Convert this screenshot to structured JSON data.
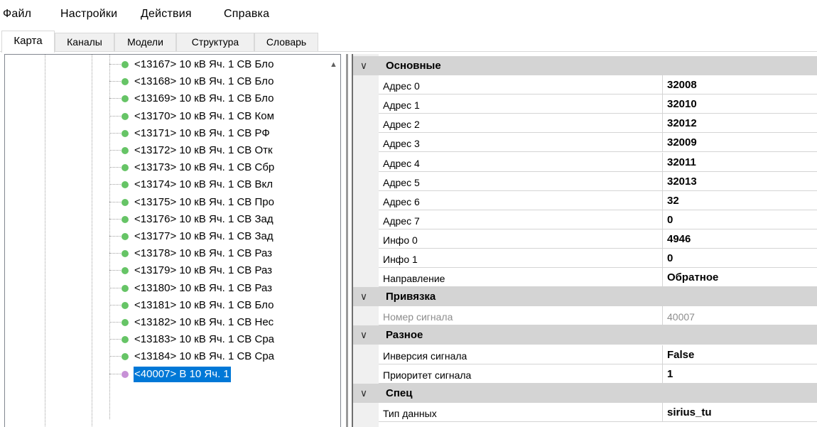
{
  "menu": [
    "Файл",
    "Настройки",
    "Действия",
    "Справка"
  ],
  "tabs": [
    "Карта",
    "Каналы",
    "Модели",
    "Структура",
    "Словарь"
  ],
  "active_tab": "Карта",
  "tree": {
    "items": [
      "<13167> 10 кВ Яч. 1 СВ Бло",
      "<13168> 10 кВ Яч. 1 СВ Бло",
      "<13169> 10 кВ Яч. 1 СВ Бло",
      "<13170> 10 кВ Яч. 1 СВ Ком",
      "<13171> 10 кВ Яч. 1 СВ РФ",
      "<13172> 10 кВ Яч. 1 СВ Отк",
      "<13173> 10 кВ Яч. 1 СВ Сбр",
      "<13174> 10 кВ Яч. 1 СВ Вкл",
      "<13175> 10 кВ Яч. 1 СВ Про",
      "<13176> 10 кВ Яч. 1 СВ Зад",
      "<13177> 10 кВ Яч. 1 СВ Зад",
      "<13178> 10 кВ Яч. 1 СВ Раз",
      "<13179> 10 кВ Яч. 1 СВ Раз",
      "<13180> 10 кВ Яч. 1 СВ Раз",
      "<13181> 10 кВ Яч. 1 СВ Бло",
      "<13182> 10 кВ Яч. 1 СВ Нес",
      "<13183> 10 кВ Яч. 1 СВ Сра",
      "<13184> 10 кВ Яч. 1 СВ Сра"
    ],
    "selected": "<40007> В 10 Яч. 1",
    "node_color": "#66c466",
    "selected_node_color": "#c791d6",
    "selection_color": "#0078d7"
  },
  "properties": {
    "categories": [
      {
        "label": "Основные",
        "rows": [
          {
            "name": "Адрес 0",
            "value": "32008"
          },
          {
            "name": "Адрес 1",
            "value": "32010"
          },
          {
            "name": "Адрес 2",
            "value": "32012"
          },
          {
            "name": "Адрес 3",
            "value": "32009"
          },
          {
            "name": "Адрес 4",
            "value": "32011"
          },
          {
            "name": "Адрес 5",
            "value": "32013"
          },
          {
            "name": "Адрес 6",
            "value": "32"
          },
          {
            "name": "Адрес 7",
            "value": "0"
          },
          {
            "name": "Инфо 0",
            "value": "4946"
          },
          {
            "name": "Инфо 1",
            "value": "0"
          },
          {
            "name": "Направление",
            "value": "Обратное"
          }
        ]
      },
      {
        "label": "Привязка",
        "rows": [
          {
            "name": "Номер сигнала",
            "value": "40007",
            "readonly": true
          }
        ]
      },
      {
        "label": "Разное",
        "rows": [
          {
            "name": "Инверсия сигнала",
            "value": "False"
          },
          {
            "name": "Приоритет сигнала",
            "value": "1"
          }
        ]
      },
      {
        "label": "Спец",
        "rows": [
          {
            "name": "Тип данных",
            "value": "sirius_tu"
          }
        ]
      }
    ]
  }
}
